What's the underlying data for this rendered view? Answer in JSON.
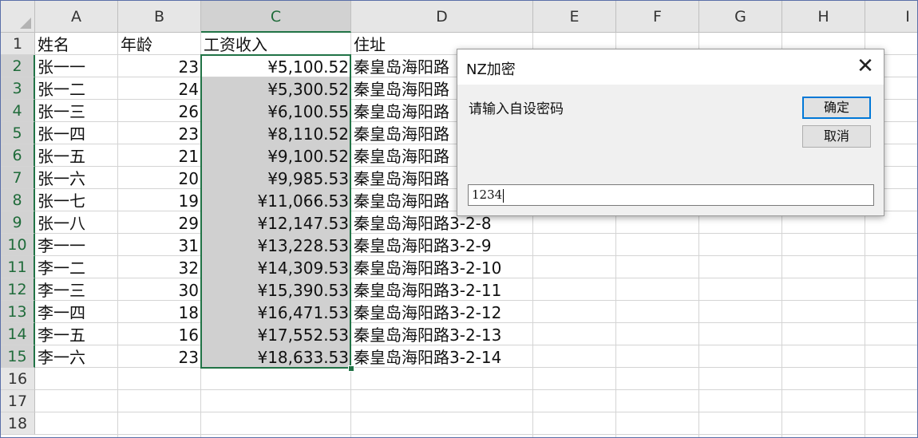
{
  "sheet": {
    "columns": [
      "A",
      "B",
      "C",
      "D",
      "E",
      "F",
      "G",
      "H",
      "I"
    ],
    "row_numbers": [
      "1",
      "2",
      "3",
      "4",
      "5",
      "6",
      "7",
      "8",
      "9",
      "10",
      "11",
      "12",
      "13",
      "14",
      "15",
      "16",
      "17",
      "18"
    ],
    "header": [
      "姓名",
      "年龄",
      "工资收入",
      "住址"
    ],
    "rows": [
      [
        "张一一",
        "23",
        "¥5,100.52",
        "秦皇岛海阳路"
      ],
      [
        "张一二",
        "24",
        "¥5,300.52",
        "秦皇岛海阳路"
      ],
      [
        "张一三",
        "26",
        "¥6,100.55",
        "秦皇岛海阳路"
      ],
      [
        "张一四",
        "23",
        "¥8,110.52",
        "秦皇岛海阳路"
      ],
      [
        "张一五",
        "21",
        "¥9,100.52",
        "秦皇岛海阳路"
      ],
      [
        "张一六",
        "20",
        "¥9,985.53",
        "秦皇岛海阳路"
      ],
      [
        "张一七",
        "19",
        "¥11,066.53",
        "秦皇岛海阳路"
      ],
      [
        "张一八",
        "29",
        "¥12,147.53",
        "秦皇岛海阳路3-2-8"
      ],
      [
        "李一一",
        "31",
        "¥13,228.53",
        "秦皇岛海阳路3-2-9"
      ],
      [
        "李一二",
        "32",
        "¥14,309.53",
        "秦皇岛海阳路3-2-10"
      ],
      [
        "李一三",
        "30",
        "¥15,390.53",
        "秦皇岛海阳路3-2-11"
      ],
      [
        "李一四",
        "18",
        "¥16,471.53",
        "秦皇岛海阳路3-2-12"
      ],
      [
        "李一五",
        "16",
        "¥17,552.53",
        "秦皇岛海阳路3-2-13"
      ],
      [
        "李一六",
        "23",
        "¥18,633.53",
        "秦皇岛海阳路3-2-14"
      ]
    ],
    "selected_range": "C2:C15",
    "selection_color": "#217346"
  },
  "dialog": {
    "title": "NZ加密",
    "prompt": "请输入自设密码",
    "ok_label": "确定",
    "cancel_label": "取消",
    "input_value": "1234",
    "close_icon": "close-icon",
    "accent": "#0078d7"
  }
}
